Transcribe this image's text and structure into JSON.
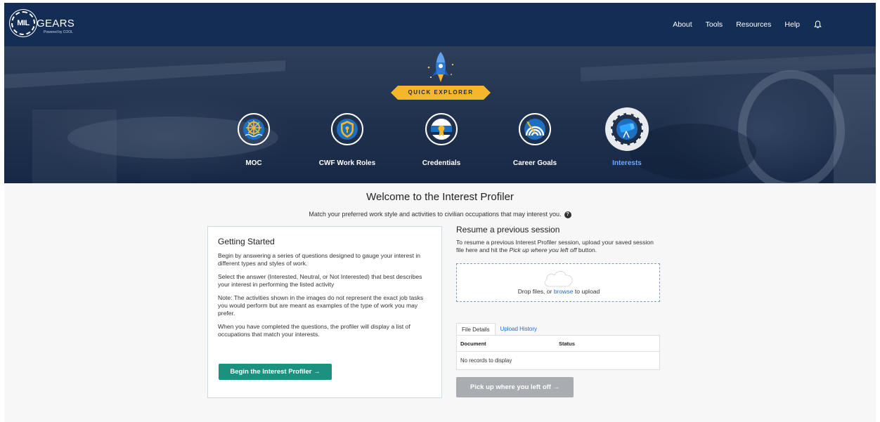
{
  "brand": {
    "badge": "MIL",
    "name": "GEARS",
    "tagline": "Powered by COOL"
  },
  "nav": {
    "links": [
      "About",
      "Tools",
      "Resources",
      "Help"
    ],
    "icons": [
      "bell-icon"
    ]
  },
  "hero": {
    "banner": "QUICK EXPLORER",
    "categories": [
      {
        "label": "MOC",
        "icon": "ship-wheel-icon",
        "active": false
      },
      {
        "label": "CWF Work Roles",
        "icon": "shield-icon",
        "active": false
      },
      {
        "label": "Credentials",
        "icon": "certificate-icon",
        "active": false
      },
      {
        "label": "Career Goals",
        "icon": "target-icon",
        "active": false
      },
      {
        "label": "Interests",
        "icon": "binoculars-icon",
        "active": true
      }
    ],
    "accent_color": "#f4b72c"
  },
  "page": {
    "title": "Welcome to the Interest Profiler",
    "subtitle": "Match your preferred work style and activities to civilian occupations that may interest you."
  },
  "getting_started": {
    "title": "Getting Started",
    "p1": "Begin by answering a series of questions designed to gauge your interest in different types and styles of work.",
    "p2": "Select the answer (Interested, Neutral, or Not Interested) that best describes your interest in performing the listed activity",
    "p3": "Note: The activities shown in the images do not represent the exact job tasks you would perform but are meant as examples of the type of work you may prefer.",
    "p4": "When you have completed the questions, the profiler will display a list of occupations that match your interests.",
    "button": "Begin the Interest Profiler →",
    "button_color": "#1d9180"
  },
  "resume": {
    "title": "Resume a previous session",
    "text_before": "To resume a previous Interest Profiler session, upload your saved session file here and hit the ",
    "text_em": "Pick up where you left off",
    "text_after": " button.",
    "drop_before": "Drop files, or ",
    "drop_link": "browse",
    "drop_after": " to upload",
    "tabs": [
      "File Details",
      "Upload History"
    ],
    "columns": [
      "Document",
      "Status"
    ],
    "empty": "No records to display",
    "button": "Pick up where you left off →"
  }
}
